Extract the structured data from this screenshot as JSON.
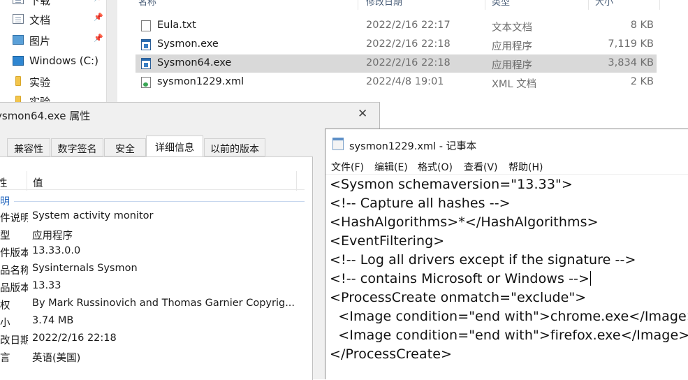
{
  "nav": {
    "items": [
      {
        "label": "下载",
        "icon": "download-icon"
      },
      {
        "label": "文档",
        "icon": "document-icon"
      },
      {
        "label": "图片",
        "icon": "picture-icon"
      },
      {
        "label": "Windows (C:)",
        "icon": "drive-icon"
      },
      {
        "label": "实验",
        "icon": "folder-icon"
      },
      {
        "label": "实验",
        "icon": "folder-icon"
      }
    ],
    "pin_glyph": "📌"
  },
  "file_list": {
    "columns": [
      "名称",
      "修改日期",
      "类型",
      "大小"
    ],
    "rows": [
      {
        "name": "Eula.txt",
        "date": "2022/2/16 22:17",
        "type": "文本文档",
        "size": "8 KB",
        "icon": "text-file-icon"
      },
      {
        "name": "Sysmon.exe",
        "date": "2022/2/16 22:18",
        "type": "应用程序",
        "size": "7,119 KB",
        "icon": "exe-file-icon"
      },
      {
        "name": "Sysmon64.exe",
        "date": "2022/2/16 22:18",
        "type": "应用程序",
        "size": "3,834 KB",
        "icon": "exe-file-icon",
        "selected": true
      },
      {
        "name": "sysmon1229.xml",
        "date": "2022/4/8 19:01",
        "type": "XML 文档",
        "size": "2 KB",
        "icon": "xml-file-icon"
      }
    ]
  },
  "properties_dialog": {
    "title": "ysmon64.exe 属性",
    "close_glyph": "✕",
    "tabs": [
      "兼容性",
      "数字签名",
      "安全",
      "详细信息",
      "以前的版本"
    ],
    "active_tab": "详细信息",
    "header_property": "性",
    "header_value": "值",
    "section": "明",
    "rows": [
      {
        "key": "件说明",
        "value": "System activity monitor"
      },
      {
        "key": "型",
        "value": "应用程序"
      },
      {
        "key": "件版本",
        "value": "13.33.0.0"
      },
      {
        "key": "品名称",
        "value": "Sysinternals Sysmon"
      },
      {
        "key": "品版本",
        "value": "13.33"
      },
      {
        "key": "权",
        "value": "By Mark Russinovich and Thomas Garnier Copyrig..."
      },
      {
        "key": "小",
        "value": "3.74 MB"
      },
      {
        "key": "改日期",
        "value": "2022/2/16 22:18"
      },
      {
        "key": "言",
        "value": "英语(美国)"
      }
    ]
  },
  "notepad": {
    "title": "sysmon1229.xml - 记事本",
    "menu": [
      "文件(F)",
      "编辑(E)",
      "格式(O)",
      "查看(V)",
      "帮助(H)"
    ],
    "lines": [
      "<Sysmon schemaversion=\"13.33\">",
      "<!-- Capture all hashes -->",
      "<HashAlgorithms>*</HashAlgorithms>",
      "<EventFiltering>",
      "<!-- Log all drivers except if the signature -->",
      "<!-- contains Microsoft or Windows -->",
      "<ProcessCreate onmatch=\"exclude\">",
      "  <Image condition=\"end with\">chrome.exe</Image>",
      "  <Image condition=\"end with\">firefox.exe</Image>",
      "</ProcessCreate>"
    ]
  }
}
